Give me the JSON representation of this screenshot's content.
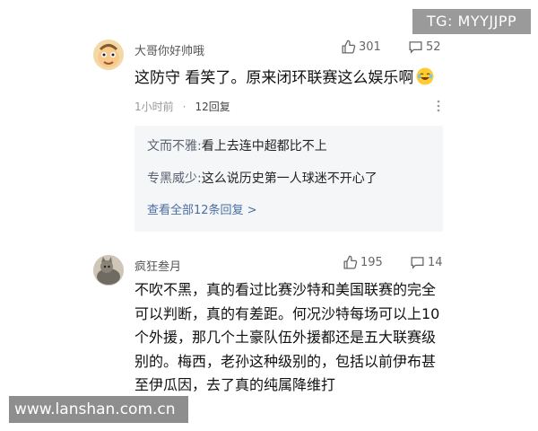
{
  "watermarks": {
    "top": "TG: MYYJJPP",
    "bottom": "www.lanshan.com.cn"
  },
  "comments": [
    {
      "username": "大哥你好帅哦",
      "likes": "301",
      "comments": "52",
      "text": "这防守 看笑了。原来闭环联赛这么娱乐啊",
      "time": "1小时前",
      "dot": "·",
      "reply_count": "12回复",
      "replies": [
        {
          "name": "文而不雅:",
          "text": "看上去连中超都比不上"
        },
        {
          "name": "专黑威少:",
          "text": "这么说历史第一人球迷不开心了"
        }
      ],
      "view_all": "查看全部12条回复 >"
    },
    {
      "username": "疯狂叁月",
      "likes": "195",
      "comments": "14",
      "text": "不吹不黑，真的看过比赛沙特和美国联赛的完全可以判断，真的有差距。何况沙特每场可以上10个外援，那几个土豪队伍外援都还是五大联赛级别的。梅西，老孙这种级别的，包括以前伊布甚至伊瓜因，去了真的纯属降维打"
    }
  ],
  "icons": {
    "like": "thumbs-up-icon",
    "comment": "comment-bubble-icon",
    "more": "more-vertical-icon",
    "emoji": "laughing-emoji-icon"
  }
}
